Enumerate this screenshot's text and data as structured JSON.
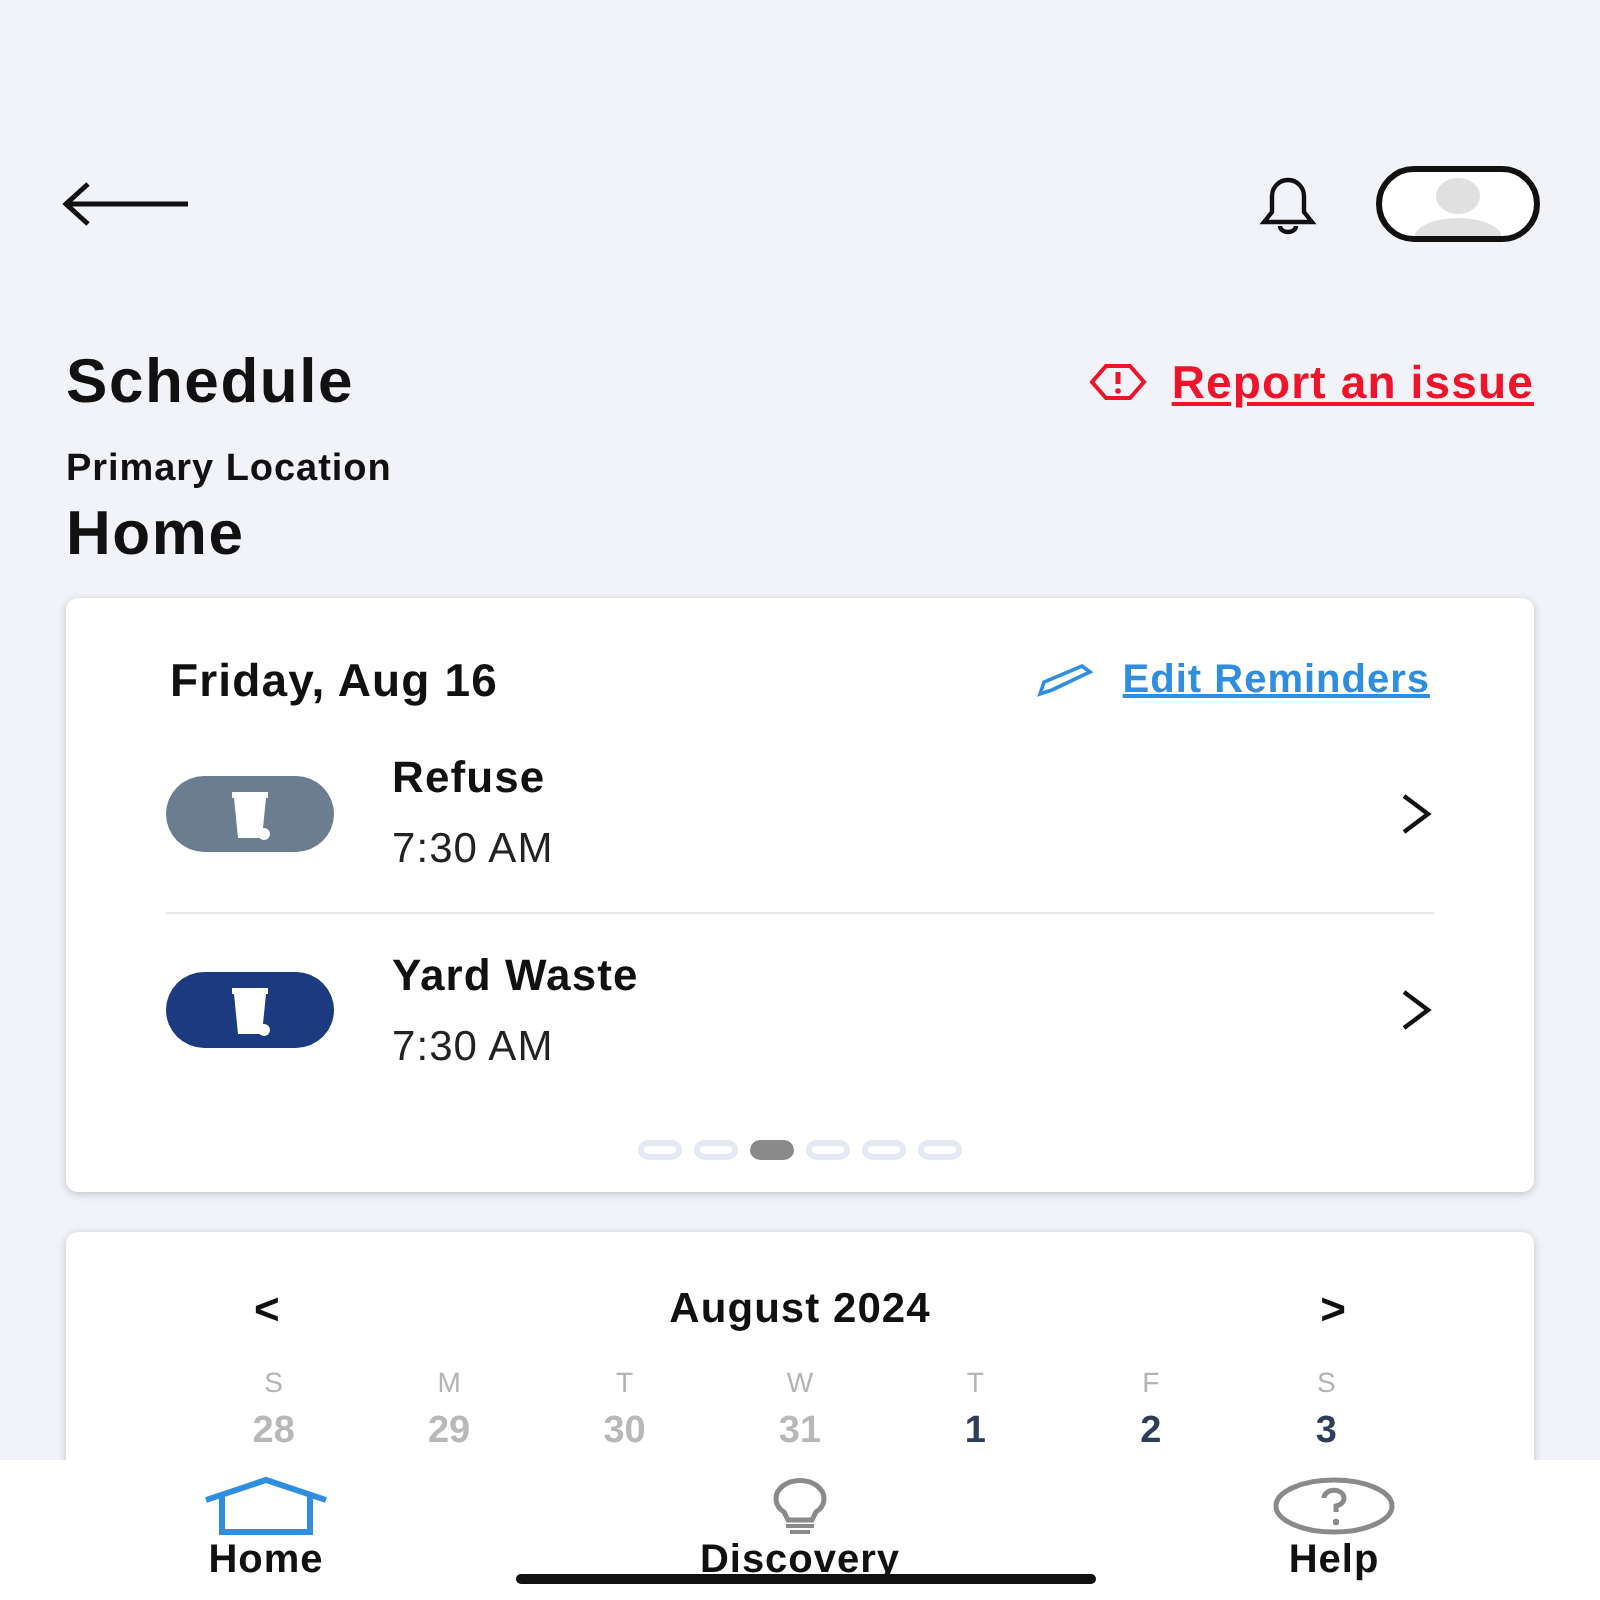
{
  "header": {
    "title": "Schedule",
    "report_link": "Report an issue",
    "location_label": "Primary Location",
    "location_name": "Home"
  },
  "pickup_card": {
    "date": "Friday, Aug 16",
    "edit_link": "Edit Reminders",
    "pickups": [
      {
        "name": "Refuse",
        "time": "7:30 AM",
        "color": "#6b7d90"
      },
      {
        "name": "Yard Waste",
        "time": "7:30 AM",
        "color": "#1b3a7f"
      }
    ],
    "pages": [
      {
        "selected": false
      },
      {
        "selected": false
      },
      {
        "selected": true
      },
      {
        "selected": false
      },
      {
        "selected": false
      },
      {
        "selected": false
      }
    ]
  },
  "calendar": {
    "prev": "<",
    "month": "August 2024",
    "next": ">",
    "weekdays": [
      "S",
      "M",
      "T",
      "W",
      "T",
      "F",
      "S"
    ],
    "days": [
      {
        "label": "28",
        "outside": true
      },
      {
        "label": "29",
        "outside": true
      },
      {
        "label": "30",
        "outside": true
      },
      {
        "label": "31",
        "outside": true
      },
      {
        "label": "1",
        "outside": false
      },
      {
        "label": "2",
        "outside": false
      },
      {
        "label": "3",
        "outside": false
      }
    ]
  },
  "bottom_nav": [
    {
      "label": "Home",
      "kind": "home",
      "selected": true
    },
    {
      "label": "Discovery",
      "kind": "discovery",
      "selected": false
    },
    {
      "label": "Help",
      "kind": "help",
      "selected": false
    }
  ]
}
